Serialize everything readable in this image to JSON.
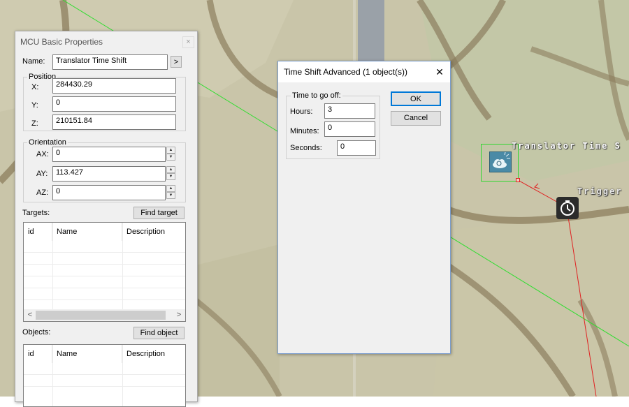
{
  "map": {
    "labels": {
      "translator": "Translator Time S",
      "trigger": "Trigger"
    },
    "icons": {
      "translator": "cloud-timeshift-icon",
      "trigger": "clock-icon"
    }
  },
  "mcu_panel": {
    "title": "MCU Basic Properties",
    "name_label": "Name:",
    "name_value": "Translator Time Shift",
    "name_arrow": ">",
    "position": {
      "title": "Position",
      "x_label": "X:",
      "x_value": "284430.29",
      "y_label": "Y:",
      "y_value": "0",
      "z_label": "Z:",
      "z_value": "210151.84"
    },
    "orientation": {
      "title": "Orientation",
      "ax_label": "AX:",
      "ax_value": "0",
      "ay_label": "AY:",
      "ay_value": "113.427",
      "az_label": "AZ:",
      "az_value": "0"
    },
    "targets": {
      "label": "Targets:",
      "button": "Find target",
      "columns": [
        "id",
        "Name",
        "Description"
      ],
      "scroll_left": "<",
      "scroll_right": ">"
    },
    "objects": {
      "label": "Objects:",
      "button": "Find object",
      "columns": [
        "id",
        "Name",
        "Description"
      ]
    }
  },
  "dialog": {
    "title": "Time Shift Advanced (1 object(s))",
    "close": "✕",
    "group_title": "Time to go off:",
    "hours_label": "Hours:",
    "hours_value": "3",
    "minutes_label": "Minutes:",
    "minutes_value": "0",
    "seconds_label": "Seconds:",
    "seconds_value": "0",
    "ok": "OK",
    "cancel": "Cancel"
  },
  "colors": {
    "map_base": "#c8c5a8",
    "road": "#8a7a5c",
    "select_green": "#2fd62f",
    "link_red": "#e02020",
    "accent_blue": "#0078d7"
  }
}
